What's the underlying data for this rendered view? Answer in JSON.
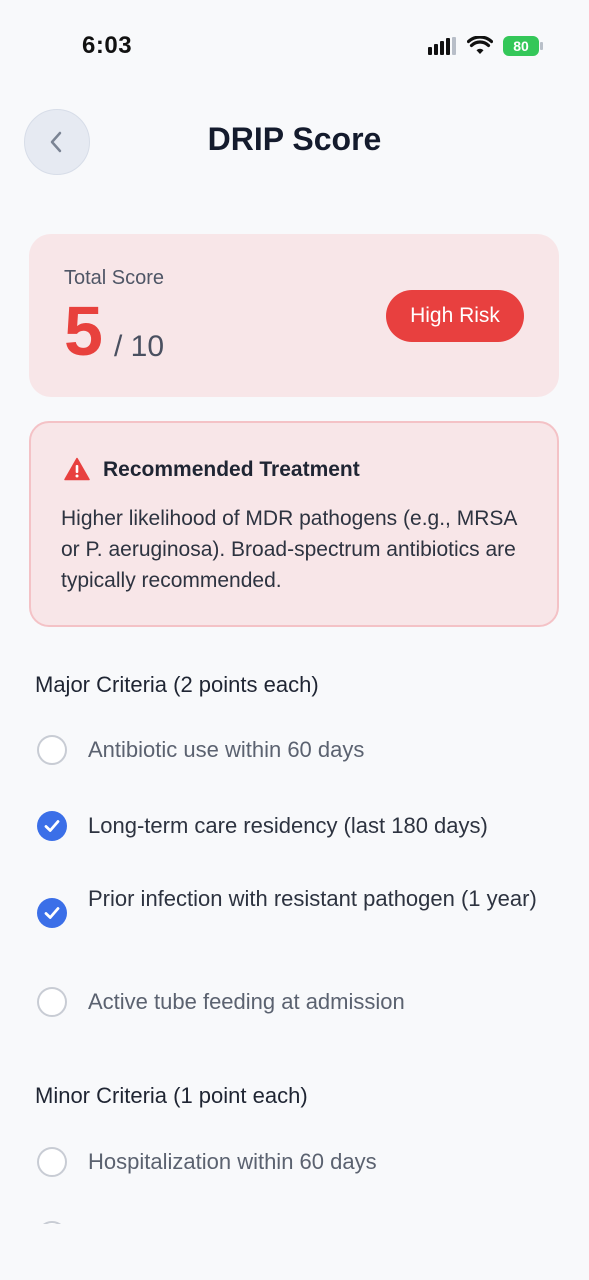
{
  "status_bar": {
    "time": "6:03",
    "battery": "80",
    "icons": [
      "signal-icon",
      "wifi-icon",
      "battery-icon"
    ]
  },
  "header": {
    "title": "DRIP Score",
    "back_icon": "chevron-left-icon"
  },
  "score": {
    "label": "Total Score",
    "value": "5",
    "max": "/ 10",
    "risk": "High Risk",
    "risk_color": "#e8403f"
  },
  "treatment": {
    "icon": "warning-icon",
    "title": "Recommended Treatment",
    "text": "Higher likelihood of MDR pathogens (e.g., MRSA or P. aeruginosa). Broad-spectrum antibiotics are typically recommended."
  },
  "major": {
    "title": "Major Criteria (2 points each)",
    "items": [
      {
        "label": "Antibiotic use within 60 days",
        "checked": false
      },
      {
        "label": "Long-term care residency (last 180 days)",
        "checked": true
      },
      {
        "label": "Prior infection with resistant pathogen (1 year)",
        "checked": true
      },
      {
        "label": "Active tube feeding at admission",
        "checked": false
      }
    ]
  },
  "minor": {
    "title": "Minor Criteria (1 point each)",
    "items": [
      {
        "label": "Hospitalization within 60 days",
        "checked": false
      }
    ]
  },
  "colors": {
    "accent": "#3b6fe8",
    "danger": "#e8413d",
    "card_bg": "#f8e6e8"
  }
}
